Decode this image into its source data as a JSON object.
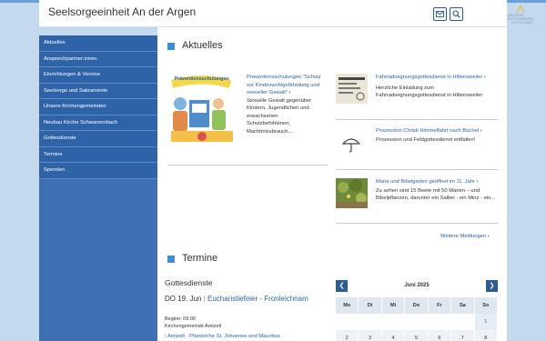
{
  "header": {
    "title": "Seelsorgeeinheit An der Argen",
    "logo_lines": [
      "DIÖZESE",
      "ROTTENBURG-",
      "STUTTGART"
    ]
  },
  "sidebar": {
    "items": [
      {
        "label": "Aktuelles"
      },
      {
        "label": "Ansprechpartner:innen"
      },
      {
        "label": "Einrichtungen & Vereine"
      },
      {
        "label": "Seelsorge und Sakramente"
      },
      {
        "label": "Unsere Kirchengemeinden"
      },
      {
        "label": "Neubau Kirche Schwarzenbach"
      },
      {
        "label": "Gottesdienste"
      },
      {
        "label": "Termine"
      },
      {
        "label": "Spenden"
      }
    ]
  },
  "aktuelles": {
    "title": "Aktuelles",
    "featured": {
      "image_text": "Präventionsschulungen",
      "link": "Präventionsschulungen \"Schutz vor Kindeswohlgefährdung und sexueller Gewalt\"",
      "text": "Sexuelle Gewalt gegenüber Kindern, Jugendlichen und erwachsenen Schutzbefohlenen, Machtmissbrauch,..."
    },
    "items": [
      {
        "link": "Fahrradsegnungsgottesdienst in Hiltensweiler",
        "text": "Herzliche Einladung zum Fahrradsegnungsgottesdienst in Hiltensweiler"
      },
      {
        "link": "Prozession Christi Himmelfahrt nach Büchel",
        "text": "Prozession und Feldgottesdienst entfallen!"
      },
      {
        "link": "Maria und Bibelgarten geöffnet im 11. Jahr",
        "text": "Zu sehen sind 15 Beete mit 50 Marien – und Bibelpflanzen, darunter ein Salbei - ein Minz - ein..."
      }
    ],
    "more": "Weitere Meldungen"
  },
  "termine": {
    "title": "Termine",
    "subtitle": "Gottesdienste",
    "event": {
      "date": "DO 19. Jun",
      "title": "Eucharistiefeier - Fronleichnam",
      "time": "Beginn:  09:00",
      "parish": "Kirchengemeinde Amtzell",
      "location": "Amtzell - Pfarrkirche St. Johannes und Mauritius"
    }
  },
  "calendar": {
    "month": "Juni 2025",
    "weekdays": [
      "Mo",
      "Di",
      "Mi",
      "Do",
      "Fr",
      "Sa",
      "So"
    ],
    "first_row": [
      "",
      "",
      "",
      "",
      "",
      "",
      "1"
    ],
    "second_row": [
      "2",
      "3",
      "4",
      "5",
      "6",
      "7",
      "8"
    ]
  }
}
